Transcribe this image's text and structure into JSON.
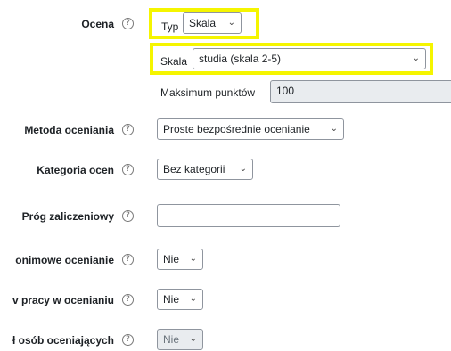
{
  "ocena": {
    "label": "Ocena",
    "typ_label": "Typ",
    "typ_value": "Skala",
    "skala_label": "Skala",
    "skala_value": "studia (skala 2-5)",
    "max_label": "Maksimum punktów",
    "max_value": "100"
  },
  "metoda": {
    "label": "Metoda oceniania",
    "value": "Proste bezpośrednie ocenianie"
  },
  "kategoria": {
    "label": "Kategoria ocen",
    "value": "Bez kategorii"
  },
  "prog": {
    "label": "Próg zaliczeniowy",
    "value": ""
  },
  "anon": {
    "label": "onimowe ocenianie",
    "value": "Nie"
  },
  "praca": {
    "label": "v pracy w ocenianiu",
    "value": "Nie"
  },
  "osob": {
    "label": "ł osób oceniających",
    "value": "Nie"
  },
  "icons": {
    "help": "?",
    "chevron": "⌄"
  },
  "colors": {
    "highlight": "#f5f500",
    "disabled_bg": "#e9ecef"
  }
}
